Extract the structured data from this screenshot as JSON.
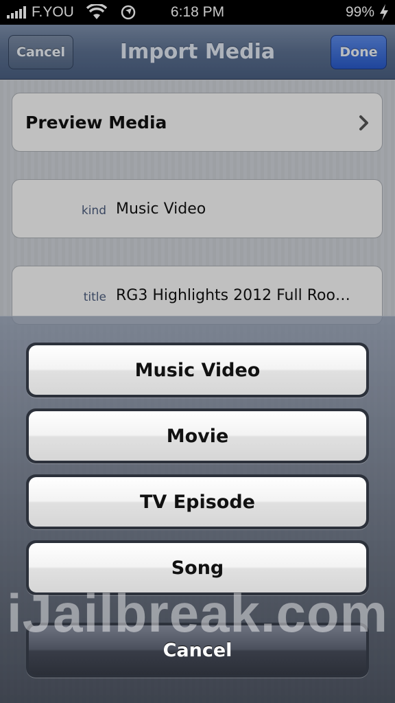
{
  "status_bar": {
    "carrier": "F.YOU",
    "time": "6:18 PM",
    "battery": "99%",
    "icons": [
      "signal-icon",
      "wifi-icon",
      "location-icon",
      "charging-icon"
    ]
  },
  "nav_bar": {
    "title": "Import Media",
    "cancel_label": "Cancel",
    "done_label": "Done"
  },
  "form": {
    "preview_label": "Preview Media",
    "fields": [
      {
        "key": "kind",
        "value": "Music Video"
      },
      {
        "key": "title",
        "value": "RG3 Highlights 2012 Full Roo…"
      }
    ]
  },
  "action_sheet": {
    "options": [
      "Music Video",
      "Movie",
      "TV Episode",
      "Song"
    ],
    "cancel_label": "Cancel"
  },
  "watermark": "iJailbreak.com",
  "colors": {
    "nav_bar": "#5b6f8f",
    "done_button": "#2859c7",
    "field_key": "#4b5c7d"
  }
}
